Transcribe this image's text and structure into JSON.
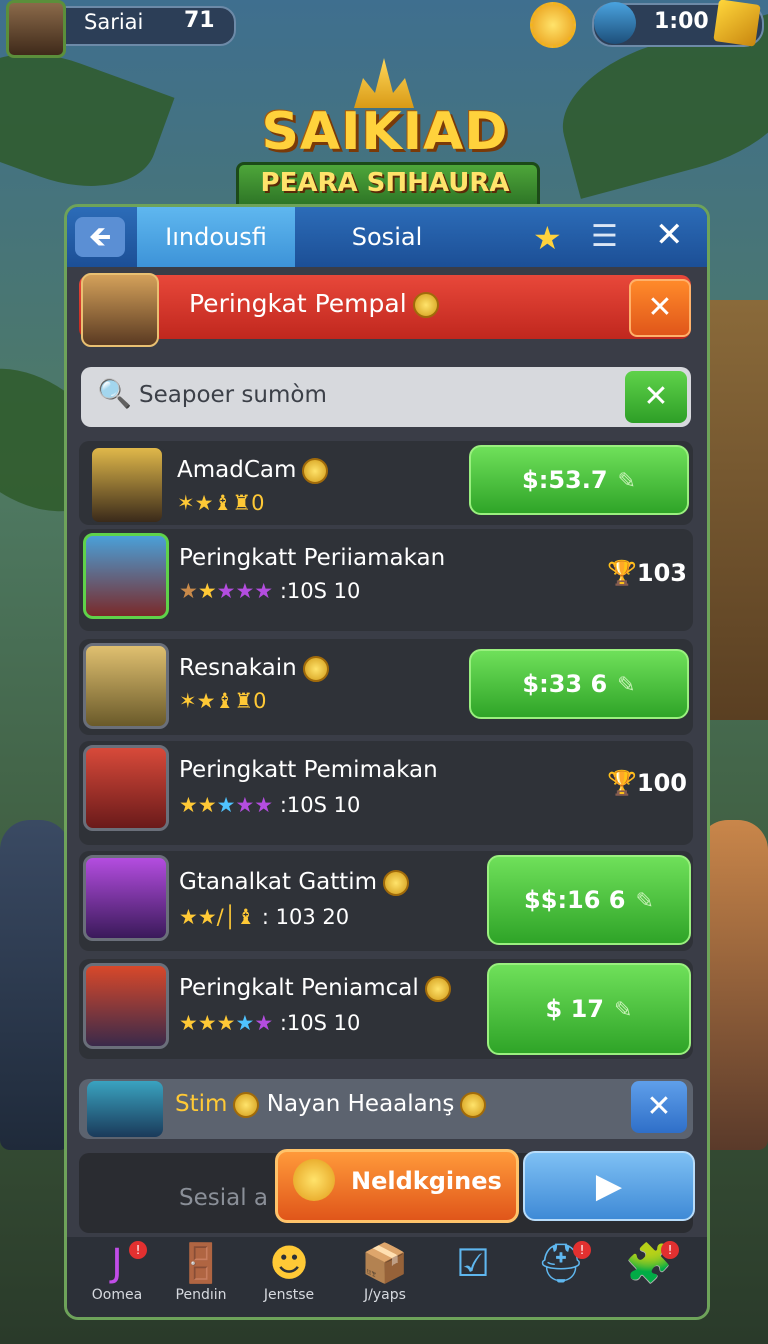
{
  "hud": {
    "player_name": "Sariai",
    "player_level": "71",
    "timer": "1:00"
  },
  "logo": {
    "title": "SAIKIAD",
    "subtitle": "PEARA SПHAURA"
  },
  "tabs": {
    "back_icon": "🡸",
    "active": "Iındousfi",
    "inactive": "Sosial",
    "star_icon": "★",
    "menu_icon": "☰",
    "close_icon": "✕"
  },
  "banner": {
    "title": "Peringkat Pempal",
    "close_icon": "✕"
  },
  "search": {
    "icon": "🔍",
    "placeholder": "Seapoer sumòm",
    "clear_icon": "✕"
  },
  "rows": [
    {
      "name": "AmadCam",
      "stars": "✶★♝♜0",
      "price": "$:53.7"
    },
    {
      "name": "Peringkatt Periiamakan",
      "stars": "★★★★★",
      "count": ":10S 10",
      "trophy": "103"
    },
    {
      "name": "Resnakain",
      "stars": "✶★♝♜0",
      "price": "$:33 6"
    },
    {
      "name": "Peringkatt Pemimakan",
      "stars": "★★★★★",
      "count": ":10S 10",
      "trophy": "100"
    },
    {
      "name": "Gtanalkat Gattim",
      "stars": "★★/│♝",
      "count": ": 103 20",
      "price": "$$:16 6"
    },
    {
      "name": "Peringkalt Peniamcal",
      "stars": "★★★★★",
      "count": ":10S 10",
      "price": "$ 17"
    }
  ],
  "bottom_row": {
    "prefix": "Stim",
    "text": "Nayan Heaalanş",
    "close_icon": "✕"
  },
  "social": {
    "label": "Sesial a",
    "cta": "Neldkgines",
    "play_icon": "▶"
  },
  "nav": [
    {
      "label": "Oomea",
      "icon": "J"
    },
    {
      "label": "Pendıin",
      "icon": "🚪"
    },
    {
      "label": "Jenstse",
      "icon": "☻"
    },
    {
      "label": "J/yaps",
      "icon": "📦"
    },
    {
      "label": "",
      "icon": "☑"
    },
    {
      "label": "",
      "icon": "⛑"
    },
    {
      "label": "",
      "icon": "🧩"
    }
  ]
}
